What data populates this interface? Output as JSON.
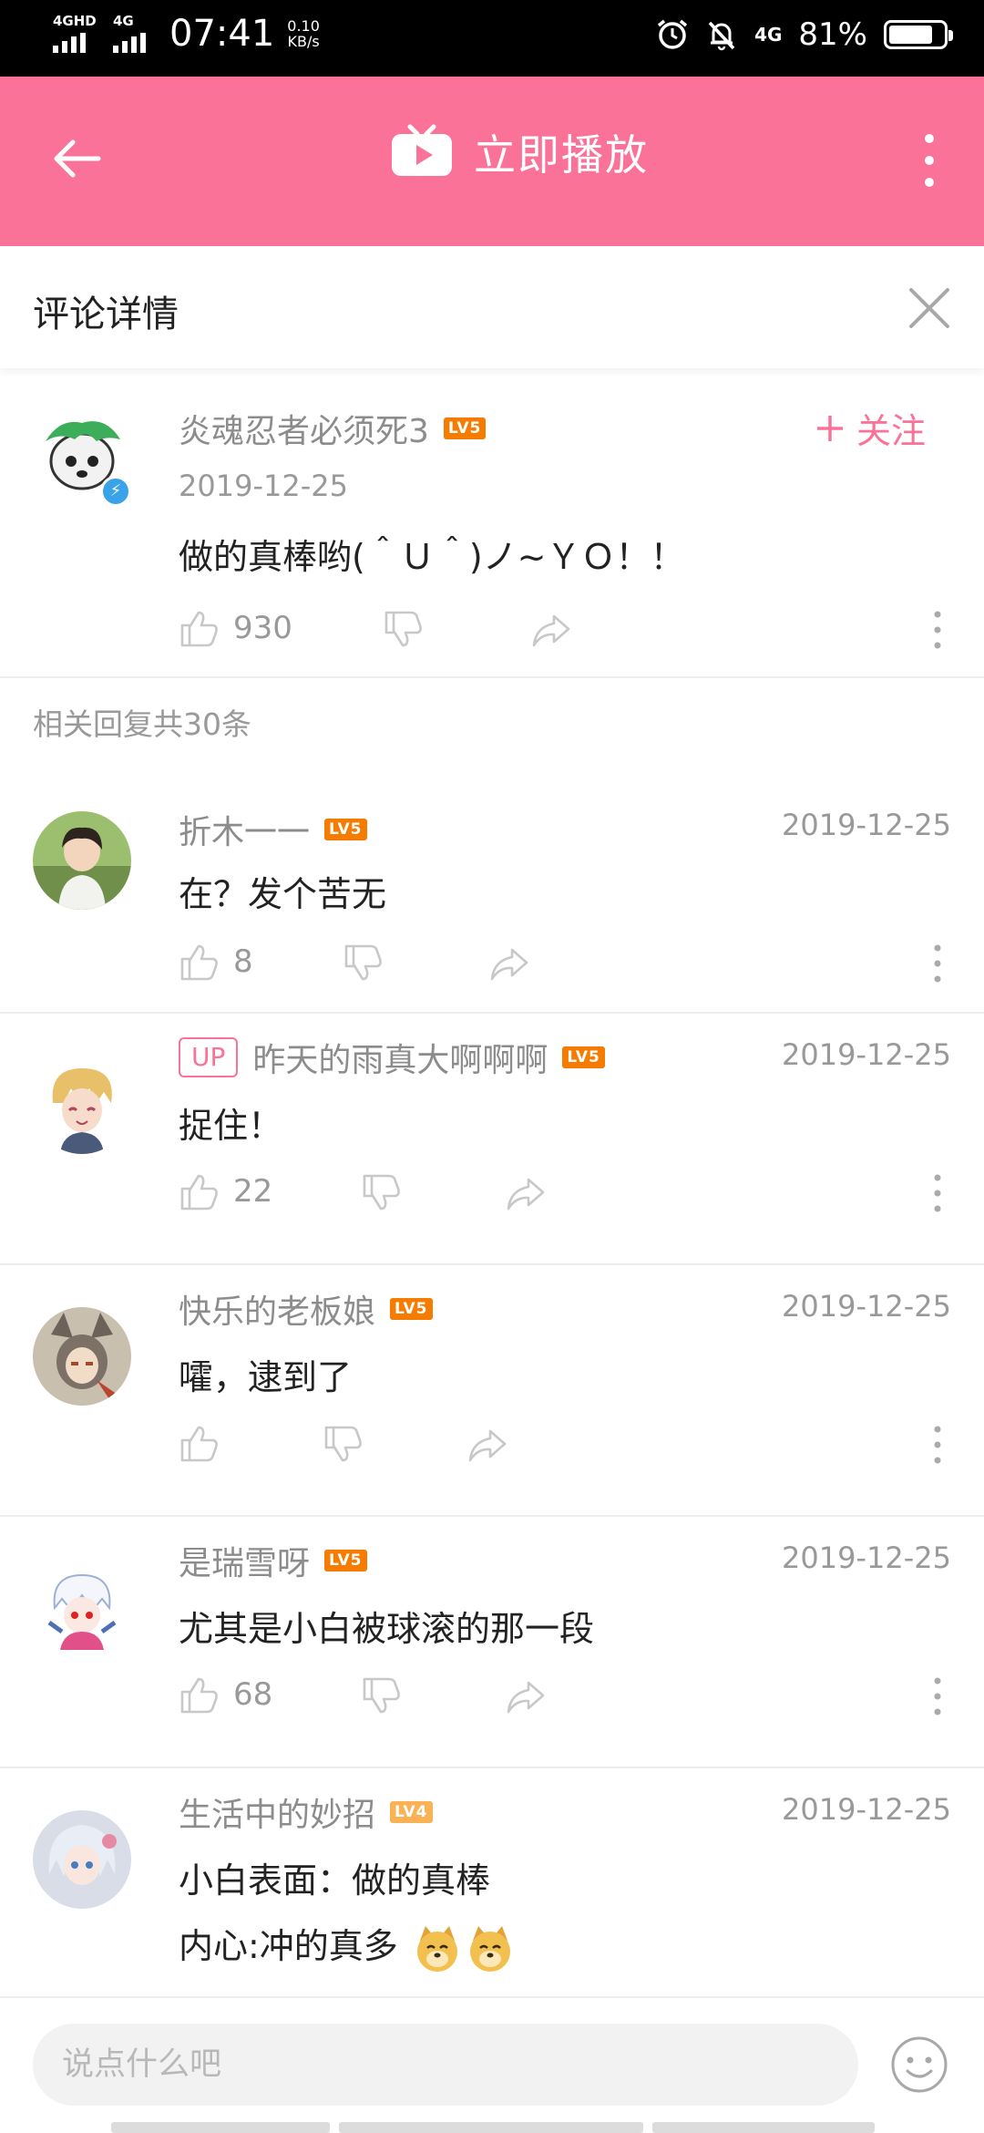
{
  "status_bar": {
    "sim1": "4GHD",
    "sim2": "4G",
    "time": "07:41",
    "speed_value": "0.10",
    "speed_unit": "KB/s",
    "network": "4G",
    "battery_text": "81%",
    "battery_level": 0.81
  },
  "header": {
    "title": "立即播放",
    "brand_color": "#fb7299"
  },
  "subheader": {
    "title": "评论详情"
  },
  "root_comment": {
    "username": "炎魂忍者必须死3",
    "level": "LV5",
    "follow_label": "关注",
    "date": "2019-12-25",
    "text": "做的真棒哟(＾Ｕ＾)ノ~ＹＯ！！",
    "likes": "930"
  },
  "replies_label": "相关回复共30条",
  "replies": [
    {
      "username": "折木一一",
      "level": "LV5",
      "date": "2019-12-25",
      "text": "在？发个苦无",
      "likes": "8"
    },
    {
      "up_tag": "UP",
      "username": "昨天的雨真大啊啊啊",
      "level": "LV5",
      "date": "2019-12-25",
      "text": "捉住！",
      "likes": "22"
    },
    {
      "username": "快乐的老板娘",
      "level": "LV5",
      "date": "2019-12-25",
      "text": "嚯，逮到了",
      "likes": ""
    },
    {
      "username": "是瑞雪呀",
      "level": "LV5",
      "date": "2019-12-25",
      "text": "尤其是小白被球滚的那一段",
      "likes": "68"
    },
    {
      "username": "生活中的妙招",
      "level": "LV4",
      "date": "2019-12-25",
      "text": "小白表面：做的真棒",
      "text2": "内心:冲的真多"
    }
  ],
  "input": {
    "placeholder": "说点什么吧"
  },
  "icons": [
    "back-arrow-icon",
    "tv-play-icon",
    "more-vertical-icon",
    "close-icon",
    "thumb-up-icon",
    "thumb-down-icon",
    "share-icon",
    "emoji-face-icon",
    "doge-emoji-icon",
    "verified-badge-icon",
    "plus-icon"
  ]
}
